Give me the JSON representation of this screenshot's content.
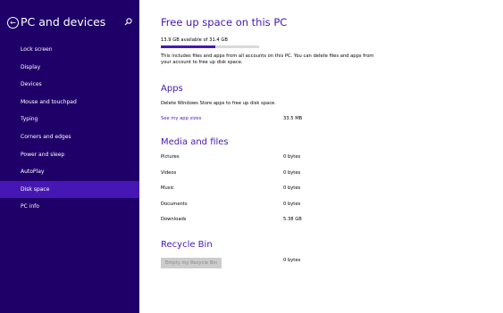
{
  "sidebar": {
    "title": "PC and devices",
    "back_icon": "back-arrow-icon",
    "search_icon": "search-icon",
    "selected_color": "#4617b4",
    "background": "#1f0068",
    "items": [
      {
        "label": "Lock screen"
      },
      {
        "label": "Display"
      },
      {
        "label": "Devices"
      },
      {
        "label": "Mouse and touchpad"
      },
      {
        "label": "Typing"
      },
      {
        "label": "Corners and edges"
      },
      {
        "label": "Power and sleep"
      },
      {
        "label": "AutoPlay"
      },
      {
        "label": "Disk space",
        "selected": true
      },
      {
        "label": "PC info"
      }
    ]
  },
  "main": {
    "title": "Free up space on this PC",
    "storage_text": "13.9 GB available of 31.4 GB",
    "used_fraction": 0.557,
    "description": "This includes files and apps from all accounts on this PC. You can delete files and apps from your account to free up disk space.",
    "apps": {
      "heading": "Apps",
      "text": "Delete Windows Store apps to free up disk space.",
      "link": "See my app sizes",
      "size": "33.5 MB"
    },
    "media": {
      "heading": "Media and files",
      "rows": [
        {
          "label": "Pictures",
          "value": "0 bytes"
        },
        {
          "label": "Videos",
          "value": "0 bytes"
        },
        {
          "label": "Music",
          "value": "0 bytes"
        },
        {
          "label": "Documents",
          "value": "0 bytes"
        },
        {
          "label": "Downloads",
          "value": "5.38 GB"
        }
      ]
    },
    "recycle": {
      "heading": "Recycle Bin",
      "button": "Empty my Recycle Bin",
      "value": "0 bytes"
    }
  }
}
